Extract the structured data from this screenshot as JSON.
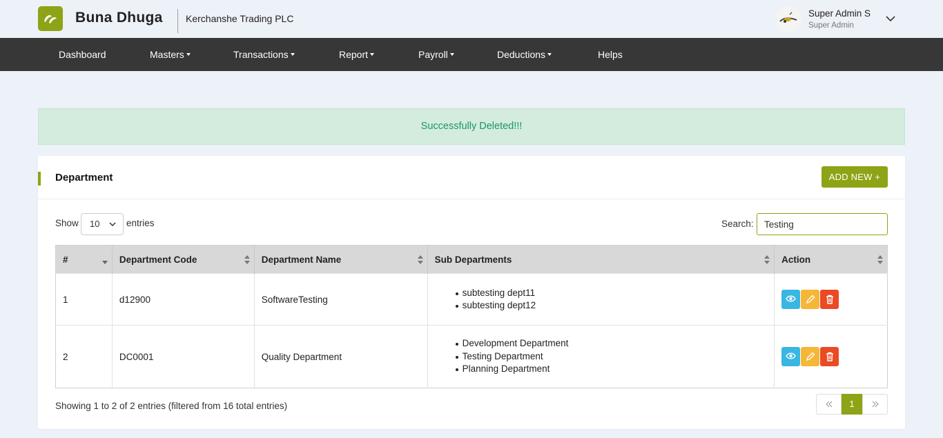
{
  "header": {
    "brand": "Buna Dhuga",
    "company": "Kerchanshe Trading PLC",
    "user_name": "Super Admin S",
    "user_role": "Super Admin"
  },
  "nav": {
    "dashboard": "Dashboard",
    "masters": "Masters",
    "transactions": "Transactions",
    "report": "Report",
    "payroll": "Payroll",
    "deductions": "Deductions",
    "helps": "Helps"
  },
  "alert": {
    "message": "Successfully Deleted!!!"
  },
  "card": {
    "title": "Department",
    "add_button": "ADD NEW +"
  },
  "controls": {
    "show_label": "Show",
    "entries_value": "10",
    "entries_label": "entries",
    "search_label": "Search:",
    "search_value": "Testing"
  },
  "table": {
    "headers": {
      "num": "#",
      "code": "Department Code",
      "name": "Department Name",
      "subs": "Sub Departments",
      "action": "Action"
    },
    "rows": [
      {
        "num": "1",
        "code": "d12900",
        "name": "SoftwareTesting",
        "subs": [
          "subtesting dept11",
          "subtesting dept12"
        ]
      },
      {
        "num": "2",
        "code": "DC0001",
        "name": "Quality Department",
        "subs": [
          "Development Department",
          "Testing Department",
          "Planning Department"
        ]
      }
    ]
  },
  "footer": {
    "info": "Showing 1 to 2 of 2 entries (filtered from 16 total entries)",
    "current_page": "1"
  },
  "colors": {
    "accent": "#8ea315",
    "nav_bg": "#373737",
    "alert_bg": "#d3ecdd",
    "alert_text": "#1a9862",
    "view": "#39b6e3",
    "edit": "#f6b636",
    "delete": "#ea4a24"
  }
}
